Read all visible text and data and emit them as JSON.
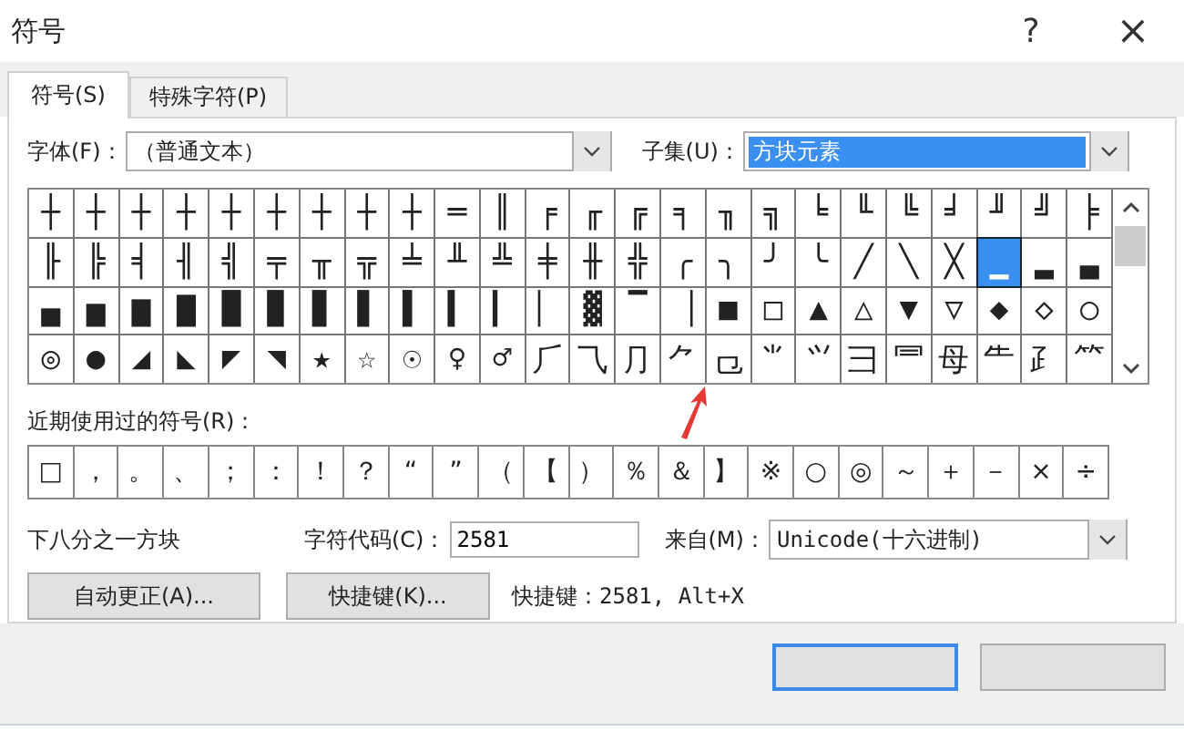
{
  "window": {
    "title": "符号",
    "help": "?",
    "close": "×"
  },
  "tabs": [
    {
      "label": "符号(S)",
      "selected": true
    },
    {
      "label": "特殊字符(P)",
      "selected": false
    }
  ],
  "font": {
    "label": "字体(F)：",
    "value": "（普通文本）"
  },
  "subset": {
    "label": "子集(U)：",
    "value": "方块元素"
  },
  "symbols": [
    [
      {
        "char": "┼",
        "selected": false
      },
      {
        "char": "┼",
        "selected": false
      },
      {
        "char": "┼",
        "selected": false
      },
      {
        "char": "┼",
        "selected": false
      },
      {
        "char": "┼",
        "selected": false
      },
      {
        "char": "┼",
        "selected": false
      },
      {
        "char": "┼",
        "selected": false
      },
      {
        "char": "┼",
        "selected": false
      },
      {
        "char": "┼",
        "selected": false
      },
      {
        "char": "═",
        "selected": false
      },
      {
        "char": "║",
        "selected": false
      },
      {
        "char": "╒",
        "selected": false
      },
      {
        "char": "╓",
        "selected": false
      },
      {
        "char": "╔",
        "selected": false
      },
      {
        "char": "╕",
        "selected": false
      },
      {
        "char": "╖",
        "selected": false
      },
      {
        "char": "╗",
        "selected": false
      },
      {
        "char": "╘",
        "selected": false
      },
      {
        "char": "╙",
        "selected": false
      },
      {
        "char": "╚",
        "selected": false
      },
      {
        "char": "╛",
        "selected": false
      },
      {
        "char": "╜",
        "selected": false
      },
      {
        "char": "╝",
        "selected": false
      },
      {
        "char": "╞",
        "selected": false
      }
    ],
    [
      {
        "char": "╟",
        "selected": false
      },
      {
        "char": "╠",
        "selected": false
      },
      {
        "char": "╡",
        "selected": false
      },
      {
        "char": "╢",
        "selected": false
      },
      {
        "char": "╣",
        "selected": false
      },
      {
        "char": "╤",
        "selected": false
      },
      {
        "char": "╥",
        "selected": false
      },
      {
        "char": "╦",
        "selected": false
      },
      {
        "char": "╧",
        "selected": false
      },
      {
        "char": "╨",
        "selected": false
      },
      {
        "char": "╩",
        "selected": false
      },
      {
        "char": "╪",
        "selected": false
      },
      {
        "char": "╫",
        "selected": false
      },
      {
        "char": "╬",
        "selected": false
      },
      {
        "char": "╭",
        "selected": false
      },
      {
        "char": "╮",
        "selected": false
      },
      {
        "char": "╯",
        "selected": false
      },
      {
        "char": "╰",
        "selected": false
      },
      {
        "char": "╱",
        "selected": false
      },
      {
        "char": "╲",
        "selected": false
      },
      {
        "char": "╳",
        "selected": false
      },
      {
        "char": "▁",
        "selected": true
      },
      {
        "char": "▂",
        "selected": false
      },
      {
        "char": "▃",
        "selected": false
      }
    ],
    [
      {
        "char": "▄",
        "selected": false
      },
      {
        "char": "▅",
        "selected": false
      },
      {
        "char": "▆",
        "selected": false
      },
      {
        "char": "▇",
        "selected": false
      },
      {
        "char": "█",
        "selected": false
      },
      {
        "char": "▉",
        "selected": false
      },
      {
        "char": "▊",
        "selected": false
      },
      {
        "char": "▋",
        "selected": false
      },
      {
        "char": "▌",
        "selected": false
      },
      {
        "char": "▍",
        "selected": false
      },
      {
        "char": "▎",
        "selected": false
      },
      {
        "char": "▏",
        "selected": false
      },
      {
        "char": "▓",
        "selected": false
      },
      {
        "char": "▔",
        "selected": false
      },
      {
        "char": "▕",
        "selected": false
      },
      {
        "char": "■",
        "selected": false
      },
      {
        "char": "□",
        "selected": false
      },
      {
        "char": "▲",
        "selected": false
      },
      {
        "char": "△",
        "selected": false
      },
      {
        "char": "▼",
        "selected": false
      },
      {
        "char": "▽",
        "selected": false
      },
      {
        "char": "◆",
        "selected": false
      },
      {
        "char": "◇",
        "selected": false
      },
      {
        "char": "○",
        "selected": false
      }
    ],
    [
      {
        "char": "◎",
        "selected": false
      },
      {
        "char": "●",
        "selected": false
      },
      {
        "char": "◢",
        "selected": false
      },
      {
        "char": "◣",
        "selected": false
      },
      {
        "char": "◤",
        "selected": false
      },
      {
        "char": "◥",
        "selected": false
      },
      {
        "char": "★",
        "selected": false
      },
      {
        "char": "☆",
        "selected": false
      },
      {
        "char": "☉",
        "selected": false
      },
      {
        "char": "♀",
        "selected": false
      },
      {
        "char": "♂",
        "selected": false
      },
      {
        "char": "⺁",
        "selected": false
      },
      {
        "char": "⺄",
        "selected": false
      },
      {
        "char": "⺆",
        "selected": false
      },
      {
        "char": "⺈",
        "selected": false
      },
      {
        "char": "⺋",
        "selected": false
      },
      {
        "char": "⺌",
        "selected": false
      },
      {
        "char": "⺍",
        "selected": false
      },
      {
        "char": "⺕",
        "selected": false
      },
      {
        "char": "⺜",
        "selected": false
      },
      {
        "char": "⺟",
        "selected": false
      },
      {
        "char": "⺧",
        "selected": false
      },
      {
        "char": "⺪",
        "selected": false
      },
      {
        "char": "⺮",
        "selected": false
      }
    ]
  ],
  "recent": {
    "label": "近期使用过的符号(R)：",
    "symbols": [
      "□",
      "，",
      "。",
      "、",
      "；",
      "：",
      "！",
      "？",
      "“",
      "”",
      "（",
      "【",
      "）",
      "％",
      "＆",
      "】",
      "※",
      "○",
      "◎",
      "～",
      "＋",
      "－",
      "×",
      "÷"
    ]
  },
  "symbol_name": "下八分之一方块",
  "char_code": {
    "label": "字符代码(C)：",
    "value": "2581"
  },
  "from": {
    "label": "来自(M)：",
    "value": "Unicode(十六进制)"
  },
  "buttons": [
    "自动更正(A)...",
    "快捷键(K)..."
  ],
  "shortcut_text": "快捷键：2581, Alt+X",
  "footer_buttons": [
    {
      "default": true
    },
    {
      "default": false
    }
  ]
}
